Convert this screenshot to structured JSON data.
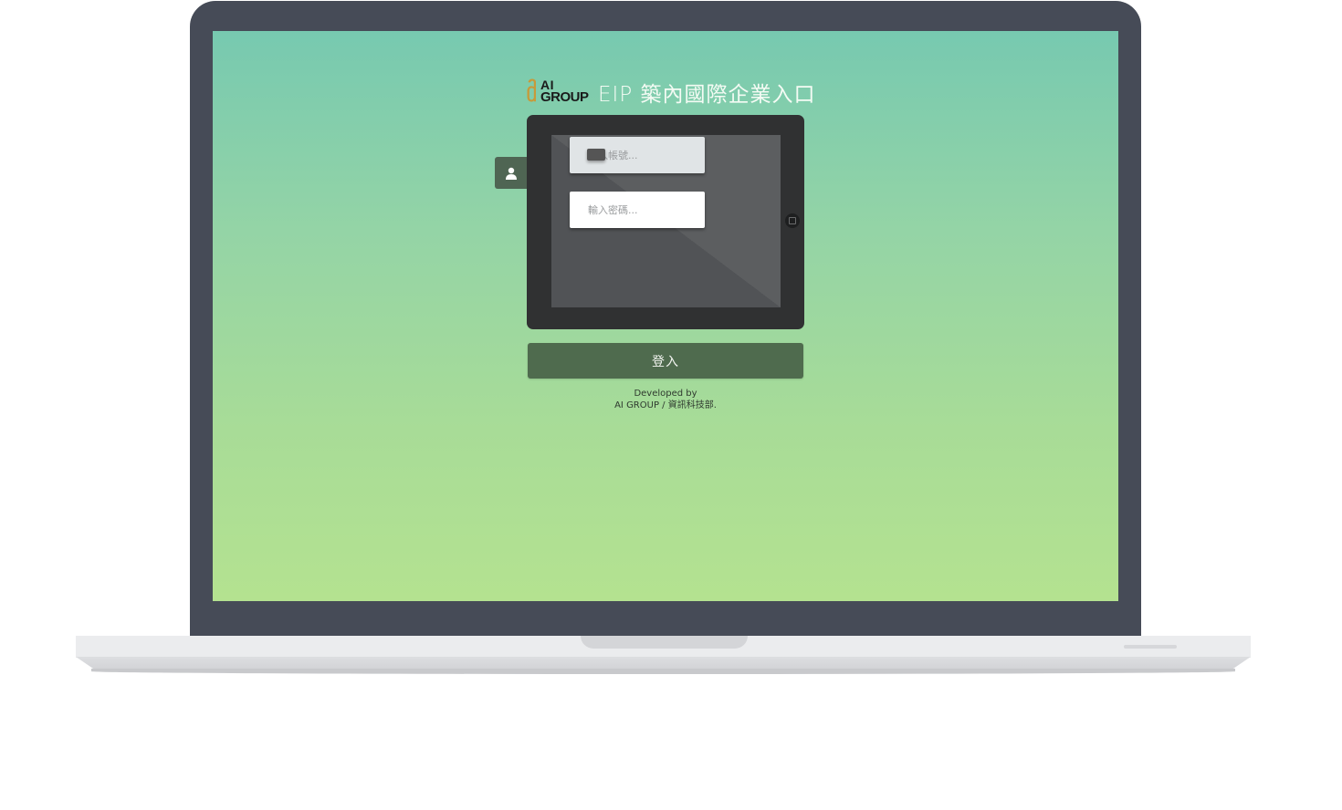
{
  "brand": {
    "logo_top": "AI",
    "logo_bottom": "GROUP",
    "portal_title": "EIP 築內國際企業入口"
  },
  "login_form": {
    "account_placeholder": "輸入帳號...",
    "password_placeholder": "輸入密碼...",
    "submit_label": "登入"
  },
  "footer": {
    "line1": "Developed by",
    "line2": "AI GROUP / 資訊科技部."
  },
  "colors": {
    "bezel": "#464b57",
    "screen_top": "#77c9b0",
    "screen_bottom": "#b4e290",
    "tablet": "#303132",
    "login_button": "#4f6b4e",
    "logo_accent": "#c79a3a"
  },
  "icons": {
    "user": "user-icon",
    "home": "home-button-icon"
  }
}
